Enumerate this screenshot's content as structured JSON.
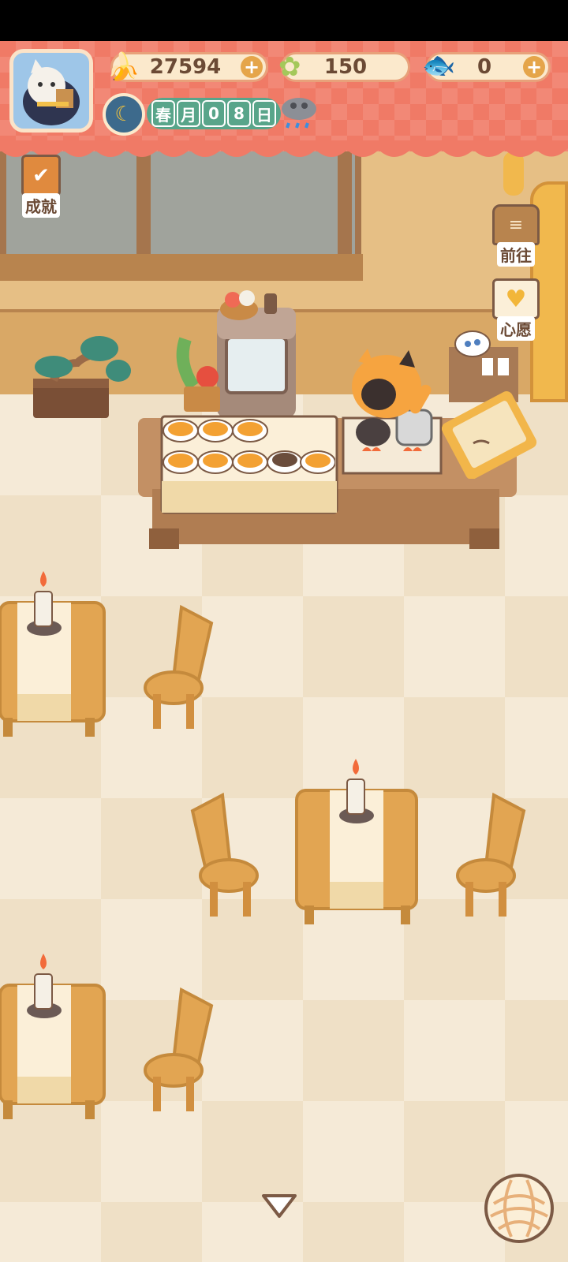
{
  "header": {
    "currency": [
      {
        "icon": "banana-icon",
        "value": "27594",
        "has_plus": true
      },
      {
        "icon": "clover-icon",
        "value": "150",
        "has_plus": false
      },
      {
        "icon": "fish-icon",
        "value": "0",
        "has_plus": true
      }
    ],
    "date": {
      "icon": "moon-time-icon",
      "chars": [
        "春",
        "月",
        "0",
        "8",
        "日"
      ],
      "weather_icon": "rain-cloud-icon"
    }
  },
  "side_buttons": {
    "achievements": {
      "label": "成就",
      "icon": "clipboard-check-icon"
    },
    "goto": {
      "label": "前往",
      "icon": "signboard-icon"
    },
    "wish": {
      "label": "心愿",
      "icon": "heart-book-icon"
    }
  },
  "bottom": {
    "collapse_icon": "triangle-down-icon",
    "yarn_icon": "yarn-ball-icon"
  },
  "colors": {
    "banner": "#f07a66",
    "pill_bg": "#fbe9cc",
    "accent": "#e5a54a",
    "date_chip": "#58a58a"
  }
}
